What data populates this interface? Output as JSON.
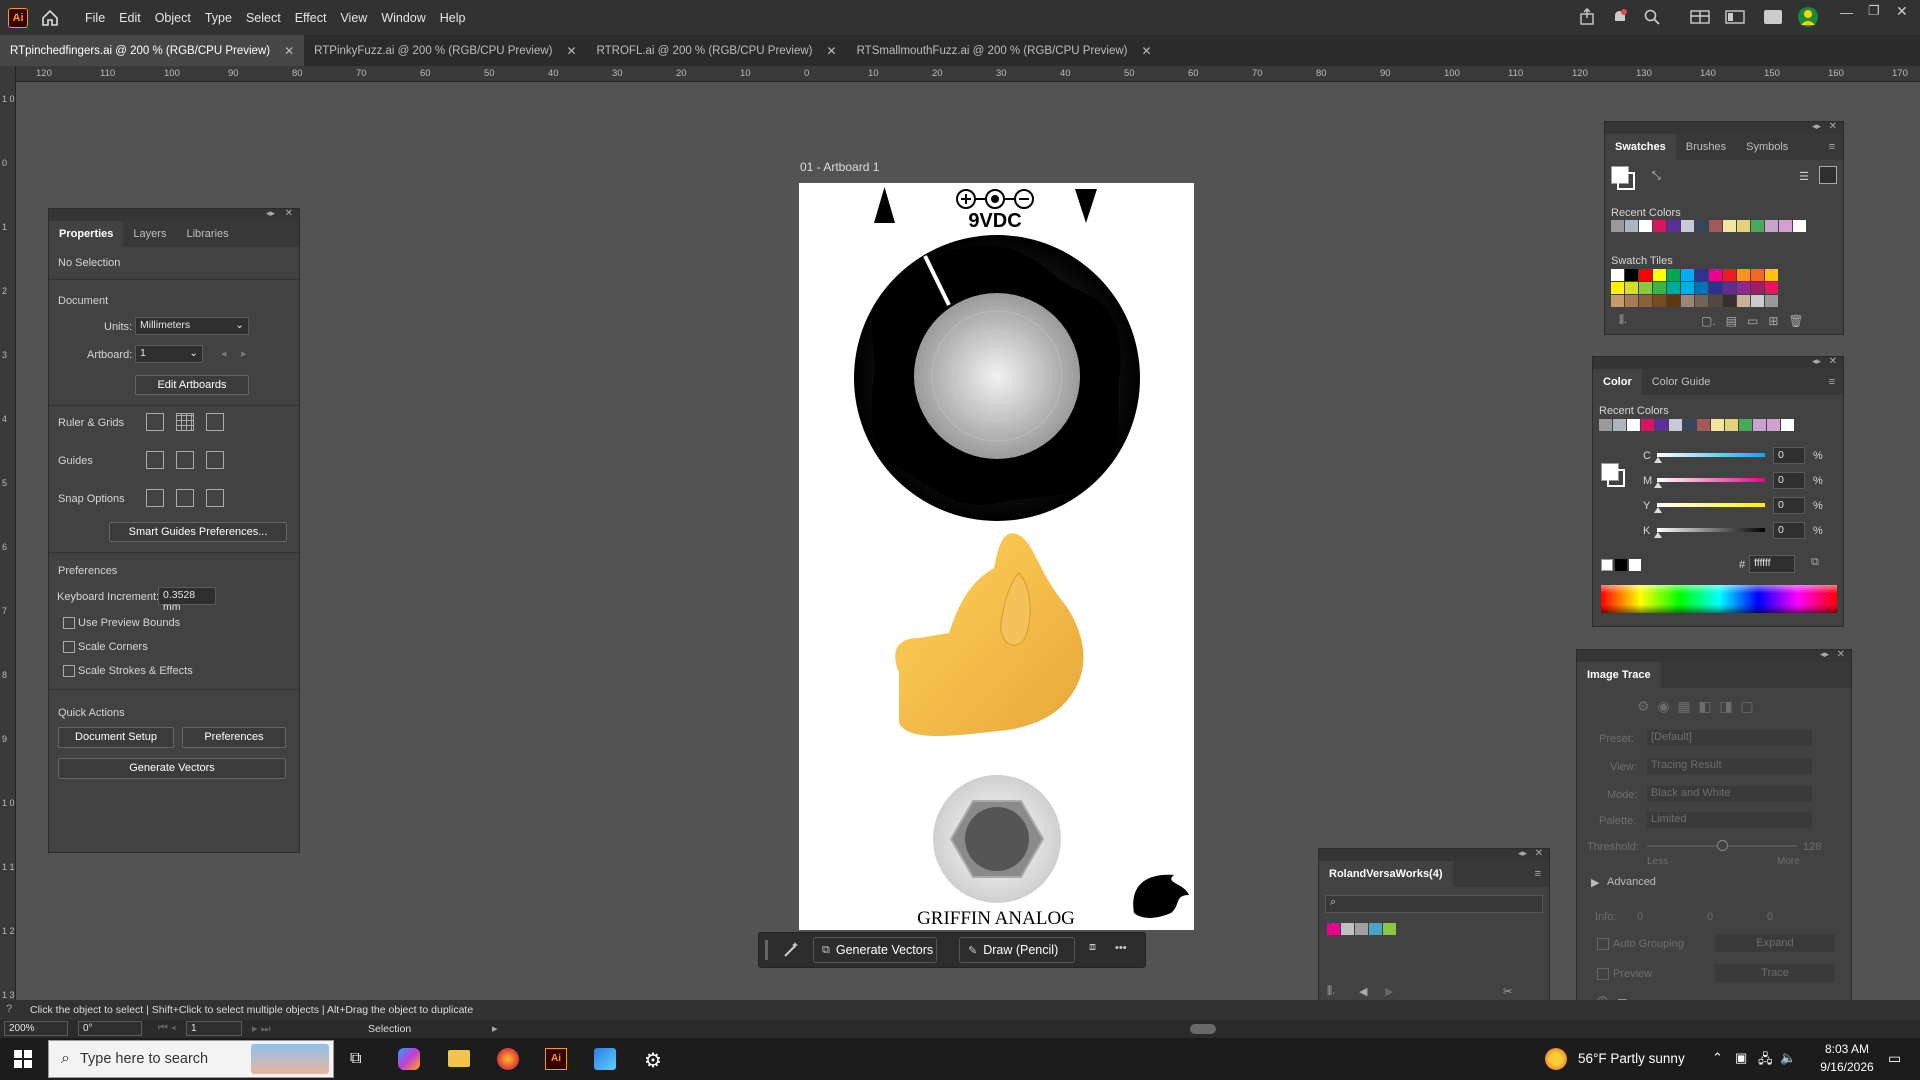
{
  "app": {
    "logo": "Ai"
  },
  "menu": [
    "File",
    "Edit",
    "Object",
    "Type",
    "Select",
    "Effect",
    "View",
    "Window",
    "Help"
  ],
  "tabs": [
    {
      "label": "RTpinchedfingers.ai @ 200 % (RGB/CPU Preview)",
      "active": true
    },
    {
      "label": "RTPinkyFuzz.ai @ 200 % (RGB/CPU Preview)",
      "active": false
    },
    {
      "label": "RTROFL.ai @ 200 % (RGB/CPU Preview)",
      "active": false
    },
    {
      "label": "RTSmallmouthFuzz.ai @ 200 % (RGB/CPU Preview)",
      "active": false
    }
  ],
  "ruler_top": [
    "120",
    "110",
    "100",
    "90",
    "80",
    "70",
    "60",
    "50",
    "40",
    "30",
    "20",
    "10",
    "0",
    "10",
    "20",
    "30",
    "40",
    "50",
    "60",
    "70",
    "80",
    "90",
    "100",
    "110",
    "120",
    "130",
    "140",
    "150",
    "160",
    "170"
  ],
  "ruler_left": [
    "1 0",
    "0",
    "1",
    "2",
    "3",
    "4",
    "5",
    "6",
    "7",
    "8",
    "9",
    "1 0",
    "1 1",
    "1 2",
    "1 3"
  ],
  "artboard": {
    "title": "01 - Artboard 1",
    "power_label": "9VDC",
    "brand": "GRIFFIN ANALOG"
  },
  "properties": {
    "tabs": [
      "Properties",
      "Layers",
      "Libraries"
    ],
    "selection": "No Selection",
    "document_label": "Document",
    "units_label": "Units:",
    "units_value": "Millimeters",
    "artboard_label": "Artboard:",
    "artboard_value": "1",
    "edit_artboards": "Edit Artboards",
    "ruler_grids": "Ruler & Grids",
    "guides": "Guides",
    "snap_options": "Snap Options",
    "smart_guides_btn": "Smart Guides Preferences...",
    "preferences_label": "Preferences",
    "kb_increment_label": "Keyboard Increment:",
    "kb_increment_value": "0.3528 mm",
    "use_preview_bounds": "Use Preview Bounds",
    "scale_corners": "Scale Corners",
    "scale_strokes": "Scale Strokes & Effects",
    "quick_actions": "Quick Actions",
    "document_setup": "Document Setup",
    "preferences_btn": "Preferences",
    "generate_vectors": "Generate Vectors"
  },
  "swatches": {
    "tabs": [
      "Swatches",
      "Brushes",
      "Symbols"
    ],
    "recent_colors": "Recent Colors",
    "swatch_tiles": "Swatch Tiles",
    "recent": [
      "#9a9a9a",
      "#aab5bf",
      "#ffffff",
      "#d8155f",
      "#5a2f9a",
      "#c8c8d8",
      "#34465a",
      "#a15a5a",
      "#f0e6a0",
      "#e4d27a",
      "#4aa85a",
      "#c6a2cc",
      "#d0a0d0",
      "#ffffff"
    ],
    "tiles_row1": [
      "#ffffff",
      "#000000",
      "#ff0000",
      "#ffff00",
      "#00a651",
      "#00aeef",
      "#2e3192",
      "#ec008c",
      "#ed1c24",
      "#f7941d",
      "#f26522",
      "#ffc20e"
    ],
    "tiles_row2": [
      "#fff200",
      "#d7df23",
      "#8dc63f",
      "#39b54a",
      "#00a99d",
      "#00aeef",
      "#0072bc",
      "#2e3192",
      "#662d91",
      "#92278f",
      "#9e1f63",
      "#ed145b"
    ],
    "tiles_row3": [
      "#c69c6d",
      "#a67c52",
      "#8c6239",
      "#754c24",
      "#603913",
      "#998675",
      "#736357",
      "#534741",
      "#362f2d",
      "#c7b299",
      "#ccc",
      "#999"
    ]
  },
  "color": {
    "tabs": [
      "Color",
      "Color Guide"
    ],
    "recent_colors": "Recent Colors",
    "channels": [
      {
        "name": "C",
        "value": "0",
        "unit": "%",
        "color": "#00aeef"
      },
      {
        "name": "M",
        "value": "0",
        "unit": "%",
        "color": "#ec008c"
      },
      {
        "name": "Y",
        "value": "0",
        "unit": "%",
        "color": "#fff200"
      },
      {
        "name": "K",
        "value": "0",
        "unit": "%",
        "color": "#000000"
      }
    ],
    "hex_label": "#",
    "hex_value": "ffffff"
  },
  "image_trace": {
    "title": "Image Trace",
    "preset_label": "Preset:",
    "preset_value": "[Default]",
    "view_label": "View:",
    "view_value": "Tracing Result",
    "mode_label": "Mode:",
    "mode_value": "Black and White",
    "palette_label": "Palette:",
    "palette_value": "Limited",
    "threshold_label": "Threshold:",
    "threshold_value": "128",
    "less": "Less",
    "more": "More",
    "advanced": "Advanced",
    "info_label": "Info:",
    "info_a": "0",
    "info_b": "0",
    "info_c": "0",
    "auto_grouping": "Auto Grouping",
    "expand": "Expand",
    "preview": "Preview",
    "trace": "Trace"
  },
  "roland": {
    "title": "RolandVersaWorks(4)",
    "search_placeholder": "",
    "swatches": [
      "#ec008c",
      "#c0c0c0",
      "#a0a0a0",
      "#4aa3c8",
      "#8dc63f"
    ]
  },
  "floatbar": {
    "generate_vectors": "Generate Vectors",
    "draw_pencil": "Draw (Pencil)",
    "more": "•••"
  },
  "status": {
    "hint": "Click the object to select  |  Shift+Click to select multiple objects  |  Alt+Drag the object to duplicate",
    "zoom": "200%",
    "rotation": "0°",
    "page": "1",
    "tool": "Selection"
  },
  "taskbar": {
    "search_placeholder": "Type here to search",
    "weather": "56°F  Partly sunny",
    "time": "8:03 AM",
    "date": "9/16/2026"
  }
}
